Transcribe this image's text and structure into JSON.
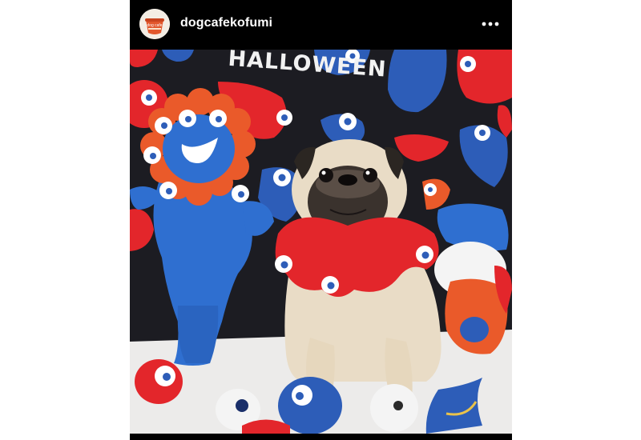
{
  "post": {
    "username": "dogcafekofumi",
    "avatar_label": "dog cafe",
    "more_icon": "more-options-icon"
  },
  "photo": {
    "banner_text": "HALLOWEEN"
  },
  "colors": {
    "background": "#ffffff",
    "header": "#000000",
    "backdrop": "#1c1c22",
    "monster_red": "#e3262b",
    "monster_blue": "#2d5db8",
    "plush_blue": "#2f6fd0",
    "pug_fawn": "#e9dcc6"
  }
}
